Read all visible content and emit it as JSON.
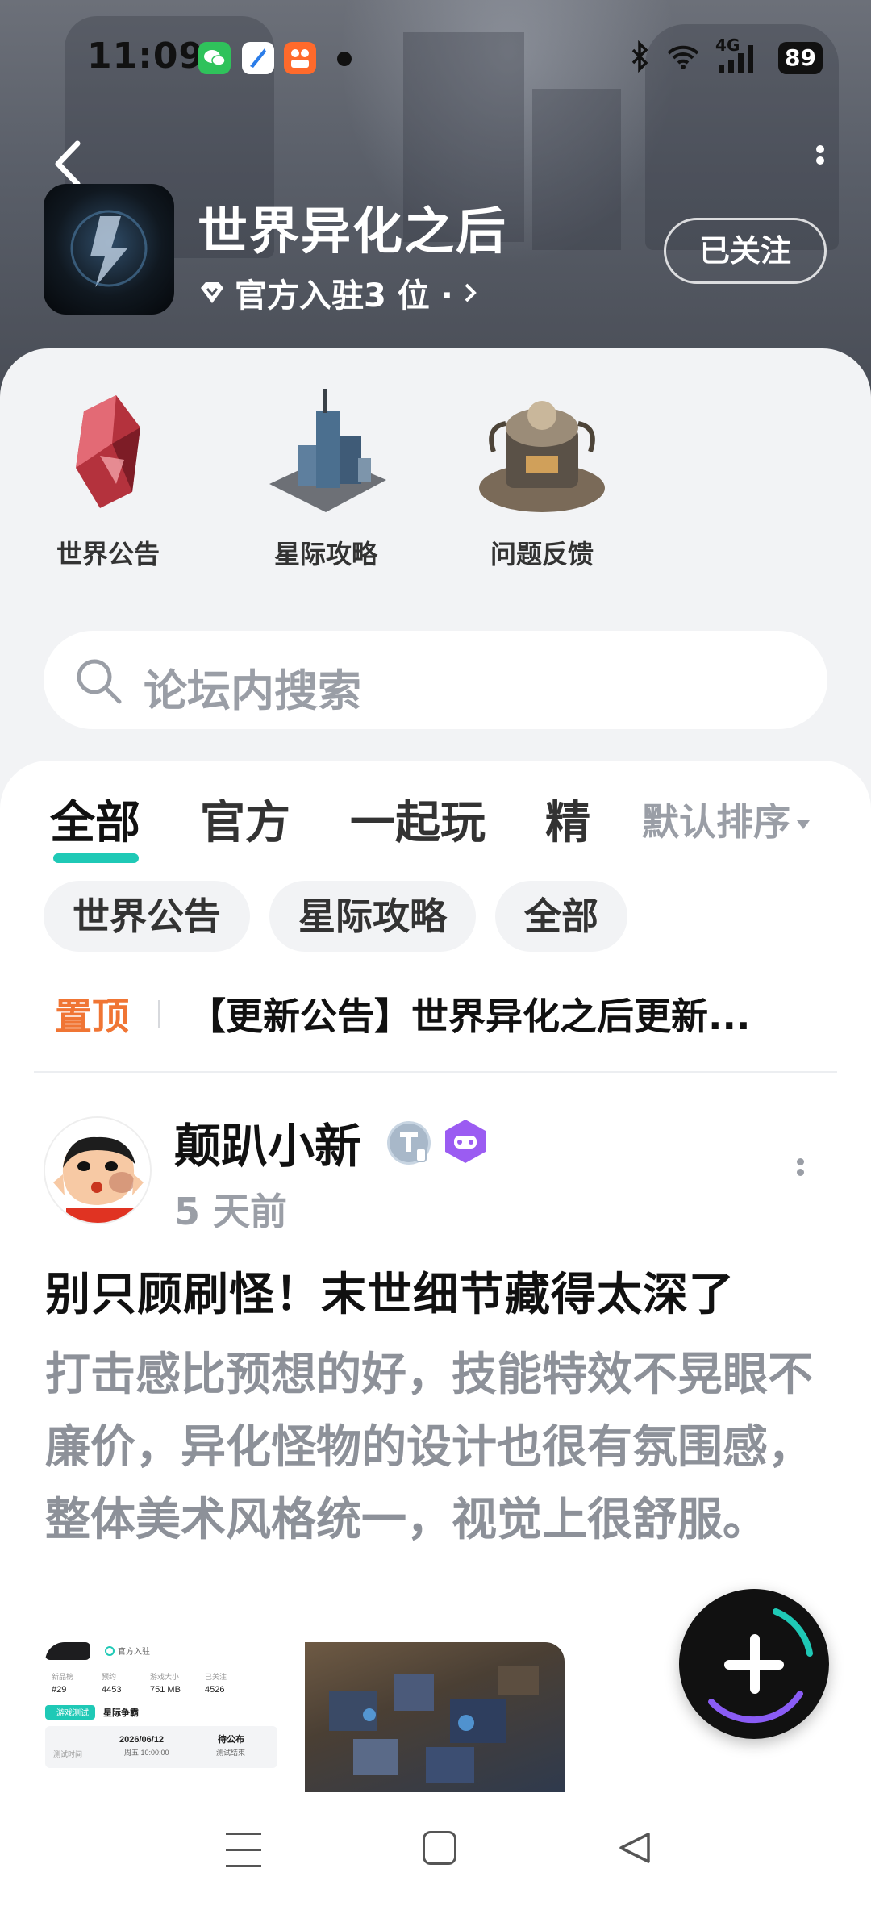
{
  "status_bar": {
    "time": "11:09",
    "network": "4G",
    "battery": "89",
    "icons": [
      "wechat-icon",
      "browser-icon",
      "app-icon",
      "bluetooth-icon",
      "wifi-icon",
      "signal-icon",
      "battery-icon"
    ]
  },
  "header": {
    "forum_title": "世界异化之后",
    "official_text": "官方入驻3 位 · ",
    "follow_label": "已关注"
  },
  "shortcuts": [
    {
      "label": "世界公告",
      "icon": "crystal-icon"
    },
    {
      "label": "星际攻略",
      "icon": "tower-icon"
    },
    {
      "label": "问题反馈",
      "icon": "machine-icon"
    }
  ],
  "search": {
    "placeholder": "论坛内搜索"
  },
  "tabs": {
    "items": [
      "全部",
      "官方",
      "一起玩",
      "精"
    ],
    "active": "全部",
    "sort_label": "默认排序"
  },
  "chips": [
    "世界公告",
    "星际攻略",
    "全部"
  ],
  "pinned": {
    "tag": "置顶",
    "text": "【更新公告】世界异化之后更新..."
  },
  "post": {
    "author": "颠趴小新",
    "time": "5 天前",
    "title": "别只顾刷怪！末世细节藏得太深了",
    "body": "打击感比预想的好，技能特效不晃眼不廉价，异化怪物的设计也很有氛围感，整体美术风格统一，视觉上很舒服。",
    "thumb_info": {
      "official": "官方入驻",
      "stats_labels": [
        "新品榜",
        "预约",
        "游戏大小",
        "已关注"
      ],
      "stats_values": [
        "#29",
        "4453",
        "751 MB",
        "4526"
      ],
      "test_tag": "游戏测试",
      "test_name": "星际争霸",
      "test_time_label": "测试时间",
      "test_date": "2026/06/12",
      "test_weekday_time": "周五 10:00:00",
      "test_status": "待公布",
      "test_status_sub": "测试结束"
    }
  },
  "colors": {
    "accent": "#1fc9b6",
    "pinned": "#f07534",
    "muted": "#9a9ea6"
  }
}
